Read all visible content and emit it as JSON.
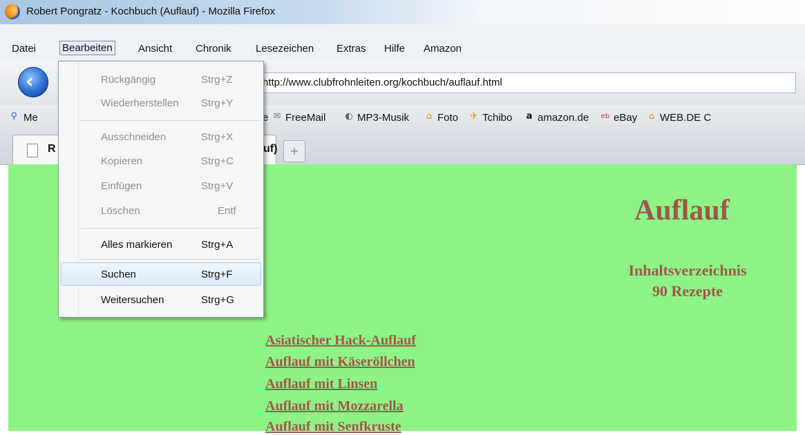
{
  "window": {
    "title": "Robert Pongratz - Kochbuch (Auflauf) - Mozilla Firefox"
  },
  "menubar": {
    "items": [
      "Datei",
      "Bearbeiten",
      "Ansicht",
      "Chronik",
      "Lesezeichen",
      "Extras",
      "Hilfe",
      "Amazon"
    ]
  },
  "navigation": {
    "url": "http://www.clubfrohnleiten.org/kochbuch/auflauf.html"
  },
  "bookmarks": {
    "partial_left": "Me",
    "partial_e": "e",
    "items": [
      "FreeMail",
      "MP3-Musik",
      "Foto",
      "Tchibo",
      "amazon.de",
      "eBay",
      "WEB.DE C"
    ]
  },
  "tabs": {
    "active_partial_left": "R",
    "active_partial_right": "uf)"
  },
  "edit_menu": {
    "items": [
      {
        "label": "Rückgängig",
        "shortcut": "Strg+Z",
        "enabled": false
      },
      {
        "label": "Wiederherstellen",
        "shortcut": "Strg+Y",
        "enabled": false
      },
      {
        "label": "Ausschneiden",
        "shortcut": "Strg+X",
        "enabled": false
      },
      {
        "label": "Kopieren",
        "shortcut": "Strg+C",
        "enabled": false
      },
      {
        "label": "Einfügen",
        "shortcut": "Strg+V",
        "enabled": false
      },
      {
        "label": "Löschen",
        "shortcut": "Entf",
        "enabled": false
      },
      {
        "label": "Alles markieren",
        "shortcut": "Strg+A",
        "enabled": true
      },
      {
        "label": "Suchen",
        "shortcut": "Strg+F",
        "enabled": true,
        "highlighted": true
      },
      {
        "label": "Weitersuchen",
        "shortcut": "Strg+G",
        "enabled": true
      }
    ]
  },
  "page": {
    "heading": "Auflauf",
    "subheading_line1": "Inhaltsverzeichnis",
    "subheading_line2": "90 Rezepte",
    "recipes": [
      "Asiatischer Hack-Auflauf",
      "Auflauf mit Käseröllchen",
      "Auflauf mit Linsen",
      "Auflauf mit Mozzarella",
      "Auflauf mit Senfkruste"
    ],
    "background_color": "#8ef485",
    "text_color": "#a0574a"
  }
}
